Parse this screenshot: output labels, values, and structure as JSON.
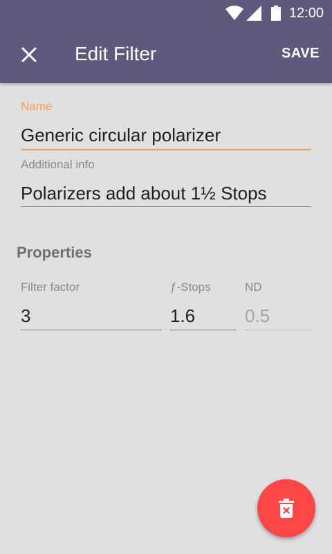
{
  "status_bar": {
    "time": "12:00"
  },
  "app_bar": {
    "title": "Edit Filter",
    "save_label": "SAVE"
  },
  "form": {
    "name": {
      "label": "Name",
      "value": "Generic circular polarizer"
    },
    "additional_info": {
      "label": "Additional info",
      "value": "Polarizers add about 1½ Stops"
    }
  },
  "properties": {
    "title": "Properties",
    "filter_factor": {
      "label": "Filter factor",
      "value": "3"
    },
    "f_stops": {
      "label": "ƒ-Stops",
      "value": "1.6"
    },
    "nd": {
      "label": "ND",
      "hint": "0.5"
    }
  },
  "colors": {
    "primary": "#5d5a7d",
    "accent": "#ff9d52",
    "fab": "#ff4747",
    "background": "#e0e0e0"
  }
}
